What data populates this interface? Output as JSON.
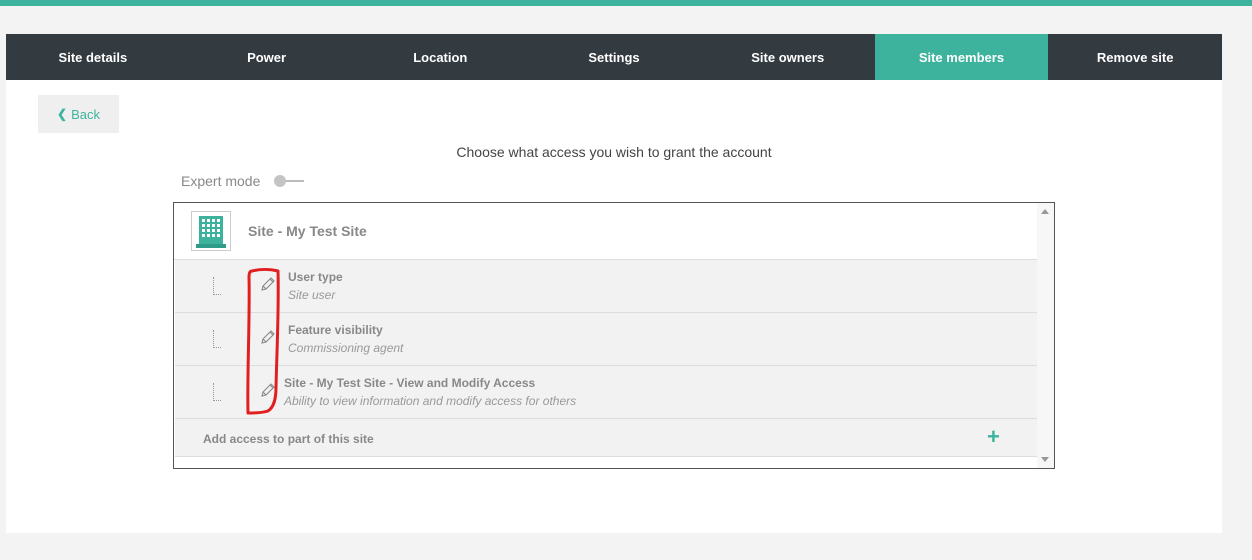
{
  "tabs": [
    {
      "label": "Site details",
      "active": false
    },
    {
      "label": "Power",
      "active": false
    },
    {
      "label": "Location",
      "active": false
    },
    {
      "label": "Settings",
      "active": false
    },
    {
      "label": "Site owners",
      "active": false
    },
    {
      "label": "Site members",
      "active": true
    },
    {
      "label": "Remove site",
      "active": false
    }
  ],
  "back": {
    "label": "Back",
    "icon": "chevron-left-icon"
  },
  "heading": "Choose what access you wish to grant the account",
  "expert_mode": {
    "label": "Expert mode",
    "enabled": false
  },
  "site": {
    "title": "Site - My Test Site",
    "icon": "building-icon"
  },
  "access_rows": [
    {
      "title": "User type",
      "subtitle": "Site user",
      "icon": "pencil-icon"
    },
    {
      "title": "Feature visibility",
      "subtitle": "Commissioning agent",
      "icon": "pencil-icon"
    },
    {
      "title": "Site - My Test Site - View and Modify Access",
      "subtitle": "Ability to view information and modify access for others",
      "icon": "pencil-icon"
    }
  ],
  "add_access": {
    "label": "Add access to part of this site",
    "icon": "plus-icon"
  },
  "colors": {
    "accent": "#3db39e",
    "tab_bg": "#333a40",
    "annotation": "#e02020"
  }
}
